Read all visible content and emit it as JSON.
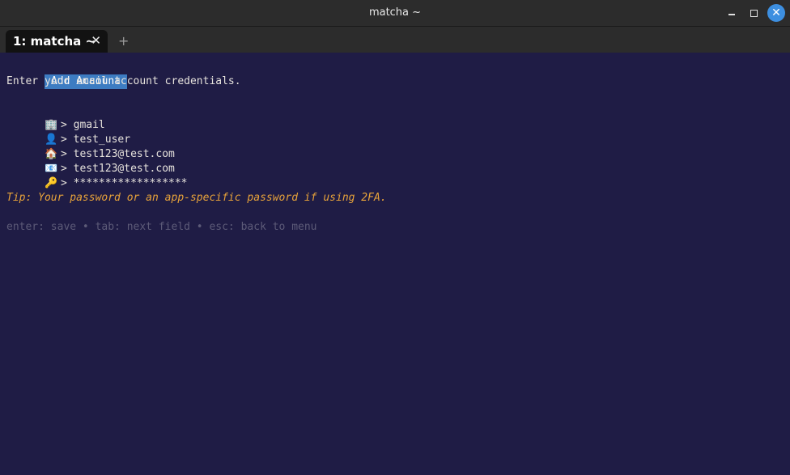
{
  "window": {
    "title": "matcha ~",
    "colors": {
      "titlebar": "#2c2c2c",
      "close_accent": "#3d8fe0",
      "terminal_bg": "#1f1c45"
    }
  },
  "tabs": {
    "active_label": "1: matcha ~",
    "close_glyph": "✕",
    "add_glyph": "+"
  },
  "form": {
    "header": "Add Account",
    "subtitle": "Enter your email account credentials.",
    "prompt_symbol": ">",
    "fields": [
      {
        "icon": "building-icon",
        "glyph": "🏢",
        "value": "gmail"
      },
      {
        "icon": "user-icon",
        "glyph": "👤",
        "value": "test_user"
      },
      {
        "icon": "house-icon",
        "glyph": "🏠",
        "value": "test123@test.com"
      },
      {
        "icon": "email-icon",
        "glyph": "📧",
        "value": "test123@test.com"
      },
      {
        "icon": "key-icon",
        "glyph": "🔑",
        "value": "******************"
      }
    ],
    "tip": "Tip: Your password or an app-specific password if using 2FA.",
    "help": "enter: save • tab: next field • esc: back to menu",
    "colors": {
      "header_bg": "#3d7cc2",
      "tip": "#e8a33a",
      "help": "#5d5b78",
      "text": "#e6e2dc"
    }
  }
}
